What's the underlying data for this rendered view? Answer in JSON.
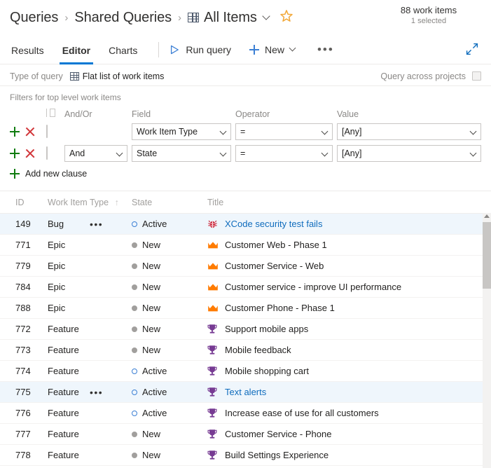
{
  "header": {
    "breadcrumb": [
      {
        "label": "Queries",
        "icon": null
      },
      {
        "label": "Shared Queries",
        "icon": null
      },
      {
        "label": "All Items",
        "icon": "grid-icon"
      }
    ],
    "separator": "›",
    "favorite_icon": "star-icon",
    "favorite_color": "#f2a93b",
    "dropdown_icon": "chevron-down-icon",
    "work_items_count": "88 work items",
    "selected_count": "1 selected"
  },
  "commandbar": {
    "tabs": [
      {
        "label": "Results",
        "active": false
      },
      {
        "label": "Editor",
        "active": true
      },
      {
        "label": "Charts",
        "active": false
      }
    ],
    "run_query_label": "Run query",
    "run_query_icon": "play-icon",
    "new_label": "New",
    "new_icon": "plus-icon",
    "overflow_label": "…",
    "overflow_icon": "ellipsis-icon",
    "expand_icon": "fullscreen-expand-icon",
    "accent_color": "#0078d4"
  },
  "query_type": {
    "label": "Type of query",
    "value": "Flat list of work items",
    "value_icon": "grid-icon",
    "across_projects_label": "Query across projects",
    "across_projects_checked": false
  },
  "filters": {
    "section_title": "Filters for top level work items",
    "columns": {
      "group": "group-clauses-icon",
      "andor": "And/Or",
      "field": "Field",
      "operator": "Operator",
      "value": "Value"
    },
    "add_icon": "plus-icon",
    "delete_icon": "close-icon",
    "rows": [
      {
        "andor": "",
        "field": "Work Item Type",
        "operator": "=",
        "value": "[Any]",
        "checked": false
      },
      {
        "andor": "And",
        "field": "State",
        "operator": "=",
        "value": "[Any]",
        "checked": false
      }
    ],
    "add_clause_label": "Add new clause"
  },
  "results_grid": {
    "columns": [
      {
        "key": "id",
        "label": "ID",
        "sort": ""
      },
      {
        "key": "type",
        "label": "Work Item Type",
        "sort": "↑"
      },
      {
        "key": "state",
        "label": "State",
        "sort": ""
      },
      {
        "key": "title",
        "label": "Title",
        "sort": ""
      }
    ],
    "row_menu_icon": "ellipsis-icon",
    "icon_colors": {
      "bug": "#cc293d",
      "epic": "#ff7b00",
      "feature": "#773b93",
      "state_new": "#a19f9d",
      "state_active": "#3b7fd4",
      "link": "#0f6cbd"
    },
    "rows": [
      {
        "id": "149",
        "type": "Bug",
        "state": "Active",
        "title": "XCode security test fails",
        "icon": "bug-icon",
        "selected": true,
        "menu": true
      },
      {
        "id": "771",
        "type": "Epic",
        "state": "New",
        "title": "Customer Web - Phase 1",
        "icon": "crown-icon",
        "selected": false,
        "menu": false
      },
      {
        "id": "779",
        "type": "Epic",
        "state": "New",
        "title": "Customer Service - Web",
        "icon": "crown-icon",
        "selected": false,
        "menu": false
      },
      {
        "id": "784",
        "type": "Epic",
        "state": "New",
        "title": "Customer service - improve UI performance",
        "icon": "crown-icon",
        "selected": false,
        "menu": false
      },
      {
        "id": "788",
        "type": "Epic",
        "state": "New",
        "title": "Customer Phone - Phase 1",
        "icon": "crown-icon",
        "selected": false,
        "menu": false
      },
      {
        "id": "772",
        "type": "Feature",
        "state": "New",
        "title": "Support mobile apps",
        "icon": "trophy-icon",
        "selected": false,
        "menu": false
      },
      {
        "id": "773",
        "type": "Feature",
        "state": "New",
        "title": "Mobile feedback",
        "icon": "trophy-icon",
        "selected": false,
        "menu": false
      },
      {
        "id": "774",
        "type": "Feature",
        "state": "Active",
        "title": "Mobile shopping cart",
        "icon": "trophy-icon",
        "selected": false,
        "menu": false
      },
      {
        "id": "775",
        "type": "Feature",
        "state": "Active",
        "title": "Text alerts",
        "icon": "trophy-icon",
        "selected": true,
        "menu": true
      },
      {
        "id": "776",
        "type": "Feature",
        "state": "Active",
        "title": "Increase ease of use for all customers",
        "icon": "trophy-icon",
        "selected": false,
        "menu": false
      },
      {
        "id": "777",
        "type": "Feature",
        "state": "New",
        "title": "Customer Service - Phone",
        "icon": "trophy-icon",
        "selected": false,
        "menu": false
      },
      {
        "id": "778",
        "type": "Feature",
        "state": "New",
        "title": "Build Settings Experience",
        "icon": "trophy-icon",
        "selected": false,
        "menu": false
      }
    ]
  }
}
